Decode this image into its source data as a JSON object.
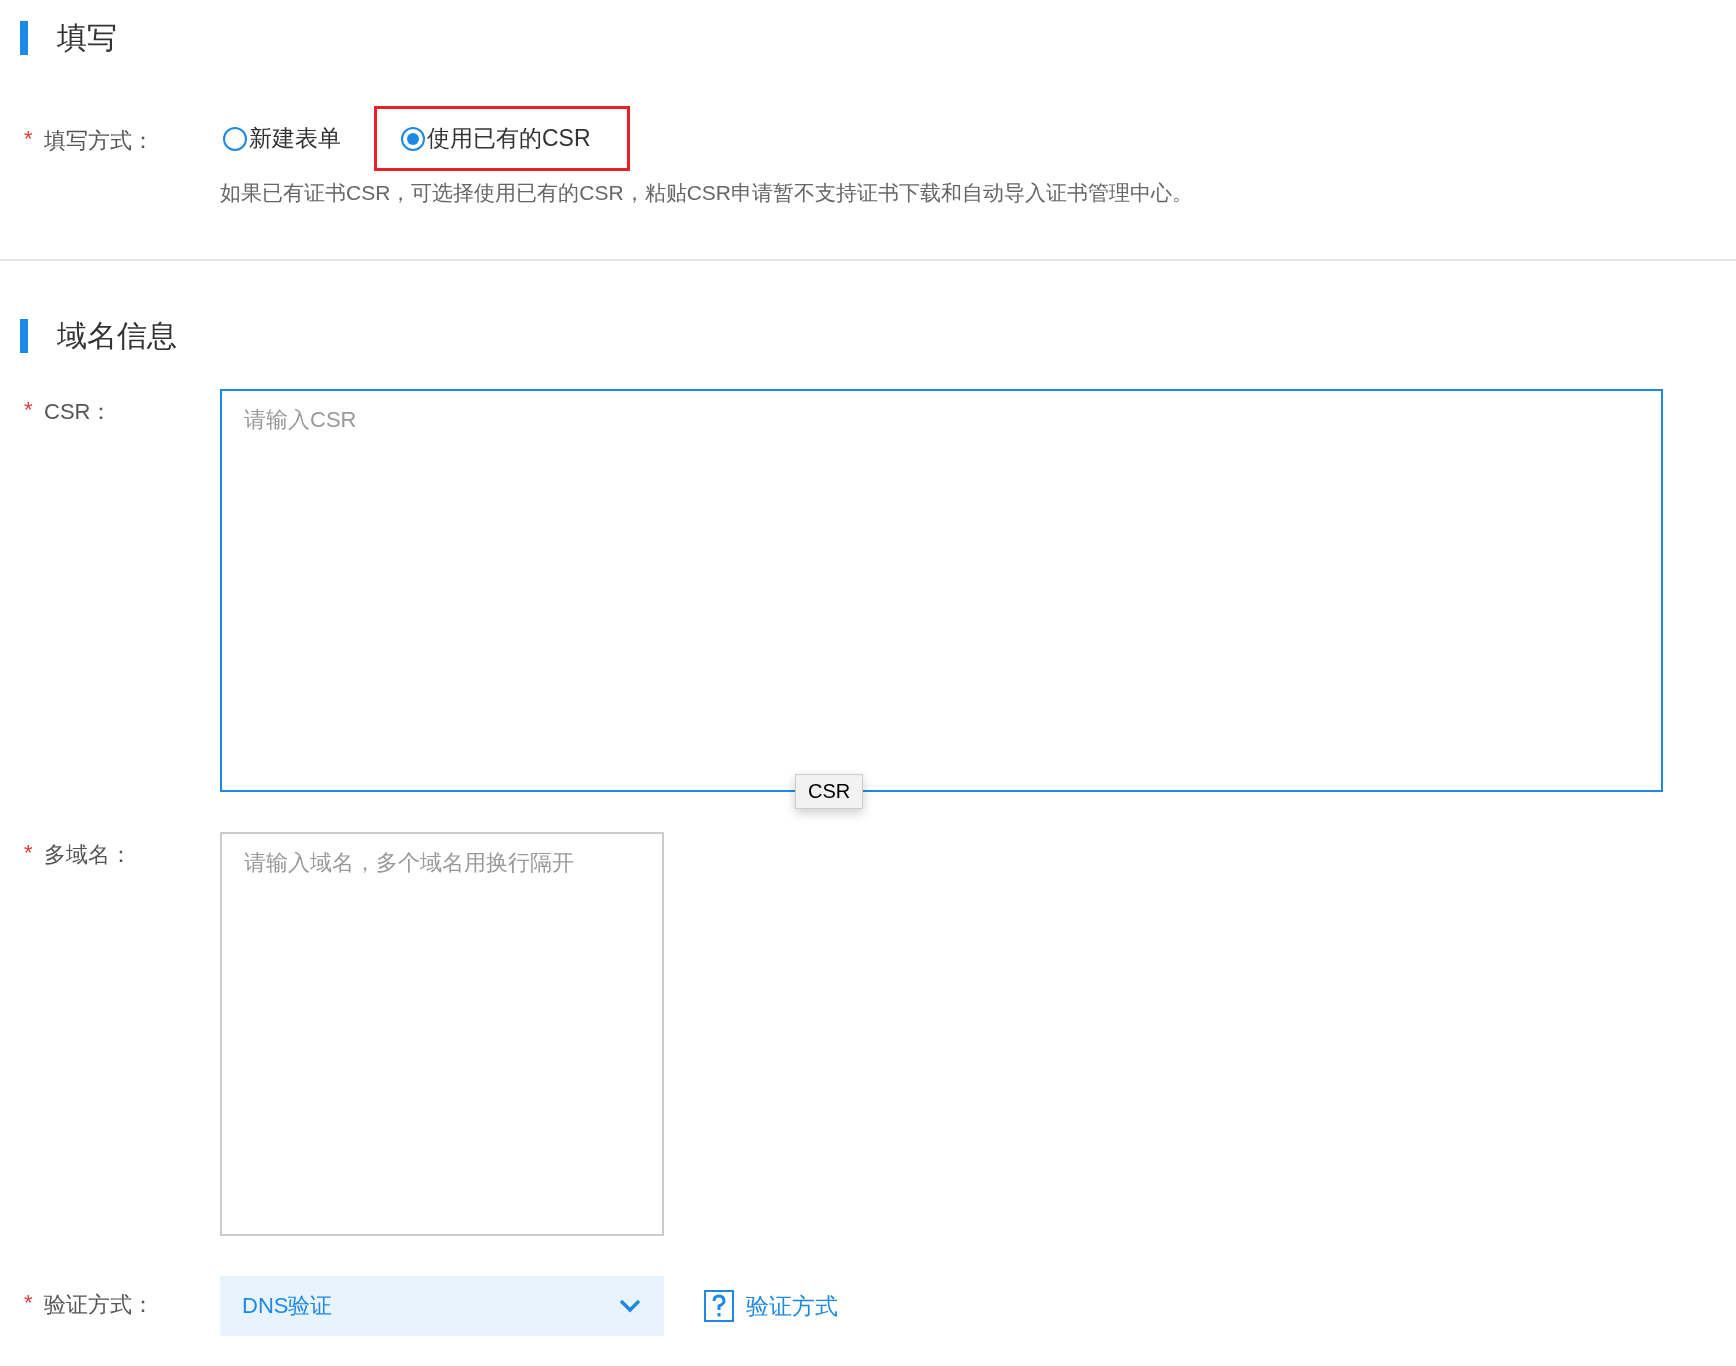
{
  "sections": [
    {
      "title": "填写",
      "fields": [
        {
          "kind": "radio",
          "label": "填写方式：",
          "required_mark": "*",
          "options": [
            {
              "label": "新建表单",
              "selected": false,
              "highlighted": false
            },
            {
              "label": "使用已有的CSR",
              "selected": true,
              "highlighted": true
            }
          ],
          "hint": "如果已有证书CSR，可选择使用已有的CSR，粘贴CSR申请暂不支持证书下载和自动导入证书管理中心。"
        }
      ]
    },
    {
      "title": "域名信息",
      "fields": [
        {
          "kind": "wide_textarea",
          "label": "CSR：",
          "required_mark": "*",
          "placeholder": "请输入CSR",
          "focused": true,
          "tooltip": "CSR"
        },
        {
          "kind": "textarea",
          "label": "多域名：",
          "required_mark": "*",
          "placeholder": "请输入域名，多个域名用换行隔开",
          "focused": false
        },
        {
          "kind": "select",
          "label": "验证方式：",
          "required_mark": "*",
          "value": "DNS验证",
          "help_link": "验证方式"
        }
      ]
    }
  ]
}
